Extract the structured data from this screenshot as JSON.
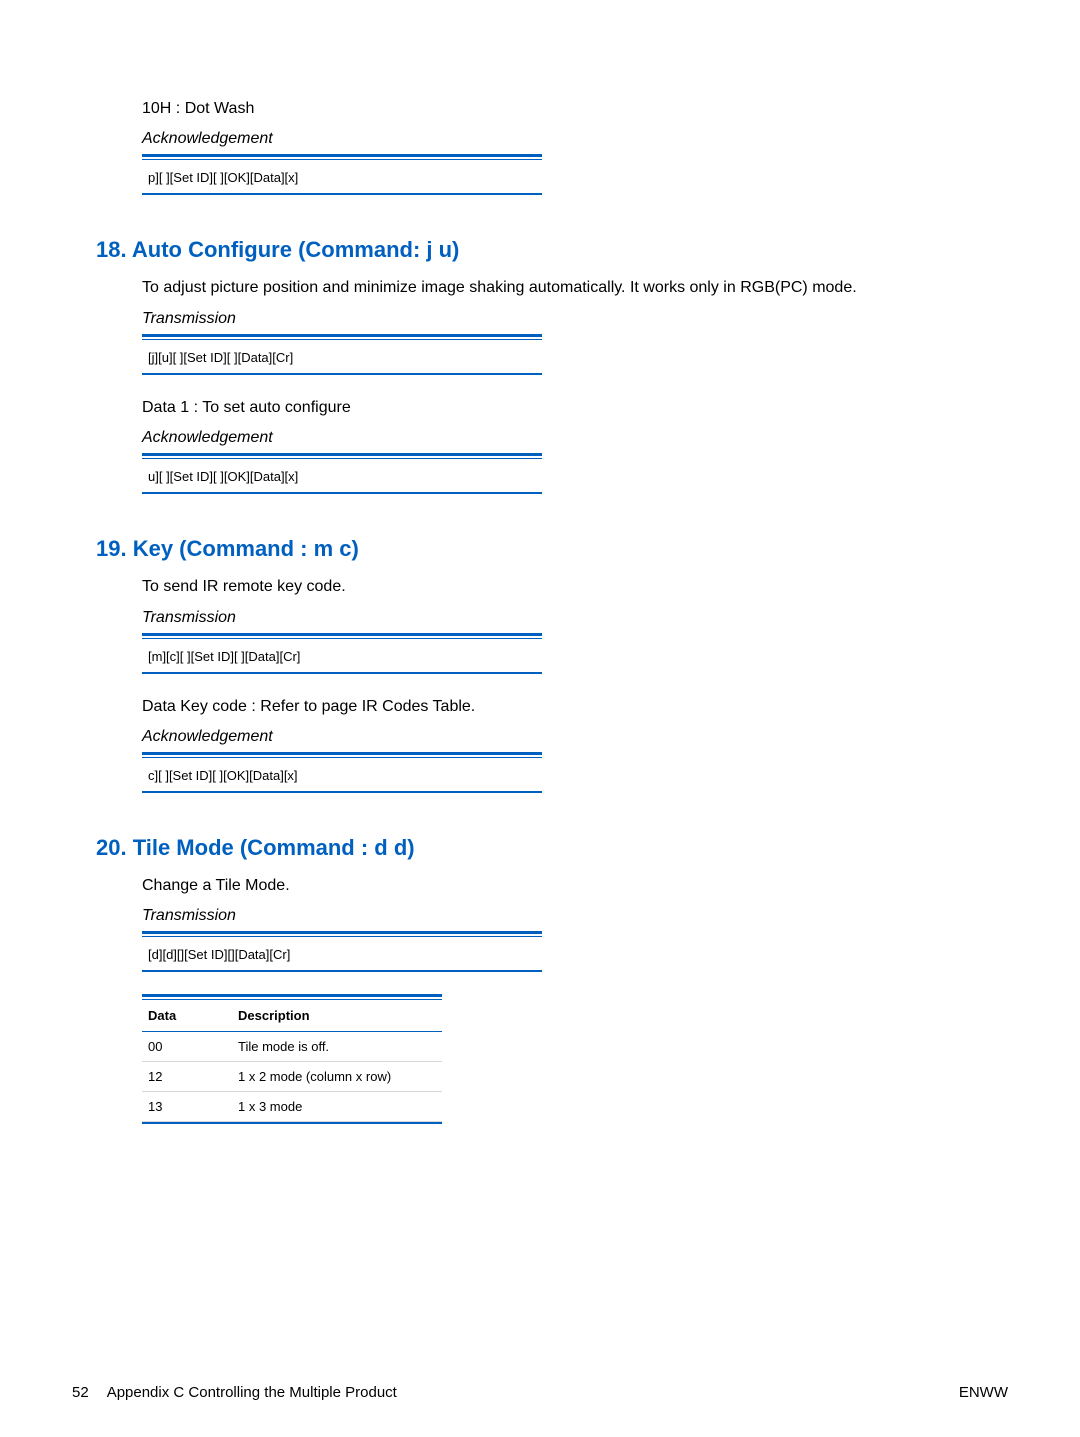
{
  "intro": {
    "dot_wash": "10H : Dot Wash",
    "ack_label": "Acknowledgement",
    "ack_code": "p][ ][Set ID][ ][OK][Data][x]"
  },
  "sections": [
    {
      "heading": "18. Auto Configure (Command: j u)",
      "description": "To adjust picture position and minimize image shaking automatically. It works only in RGB(PC) mode.",
      "trans_label": "Transmission",
      "trans_code": "[j][u][ ][Set ID][ ][Data][Cr]",
      "data_note": "Data 1 : To set auto configure",
      "ack_label": "Acknowledgement",
      "ack_code": "u][ ][Set ID][ ][OK][Data][x]"
    },
    {
      "heading": "19. Key (Command : m c)",
      "description": "To send IR remote key code.",
      "trans_label": "Transmission",
      "trans_code": "[m][c][ ][Set ID][ ][Data][Cr]",
      "data_note": "Data Key code : Refer to page IR Codes Table.",
      "ack_label": "Acknowledgement",
      "ack_code": "c][ ][Set ID][ ][OK][Data][x]"
    },
    {
      "heading": "20. Tile Mode (Command : d d)",
      "description": "Change a Tile Mode.",
      "trans_label": "Transmission",
      "trans_code": "[d][d][][Set ID][][Data][Cr]"
    }
  ],
  "table": {
    "headers": {
      "c1": "Data",
      "c2": "Description"
    },
    "rows": [
      {
        "c1": "00",
        "c2": "Tile mode is off."
      },
      {
        "c1": "12",
        "c2": "1 x 2 mode (column x row)"
      },
      {
        "c1": "13",
        "c2": "1 x 3 mode"
      }
    ]
  },
  "footer": {
    "page_number": "52",
    "appendix": "Appendix C   Controlling the Multiple Product",
    "right": "ENWW"
  }
}
